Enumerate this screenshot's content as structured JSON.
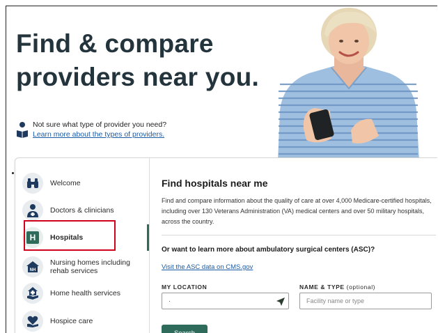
{
  "hero": {
    "title_line1": "Find & compare",
    "title_line2": "providers near you."
  },
  "helper": {
    "icon": "reader-book-icon",
    "question": "Not sure what type of provider you need?",
    "link": "Learn more about the types of providers."
  },
  "photo": {
    "subject": "woman-holding-phone"
  },
  "sidebar": {
    "items": [
      {
        "label": "Welcome",
        "icon": "binoculars-icon"
      },
      {
        "label": "Doctors & clinicians",
        "icon": "doctor-icon"
      },
      {
        "label": "Hospitals",
        "icon": "hospital-h-icon",
        "badge": "H",
        "active": true
      },
      {
        "label": "Nursing homes including rehab services",
        "icon": "nursing-home-icon",
        "badge": "NH"
      },
      {
        "label": "Home health services",
        "icon": "home-health-icon"
      },
      {
        "label": "Hospice care",
        "icon": "hospice-icon"
      }
    ]
  },
  "main": {
    "heading": "Find hospitals near me",
    "description": "Find and compare information about the quality of care at over 4,000 Medicare-certified hospitals, including over 130 Veterans Administration (VA) medical centers and over 50 military hospitals, across the country.",
    "asc_question": "Or want to learn more about ambulatory surgical centers (ASC)?",
    "asc_link": "Visit the ASC data on CMS.gov",
    "location_label": "MY LOCATION",
    "location_value": "·",
    "type_label": "NAME & TYPE",
    "type_label_optional": "(optional)",
    "type_placeholder": "Facility name or type",
    "search_label": "Search"
  },
  "colors": {
    "brand_green": "#2e6b5b",
    "title_dark": "#24343c",
    "link_blue": "#1a5ca8",
    "highlight_red": "#d0021b",
    "icon_navy": "#1f3a5f"
  }
}
